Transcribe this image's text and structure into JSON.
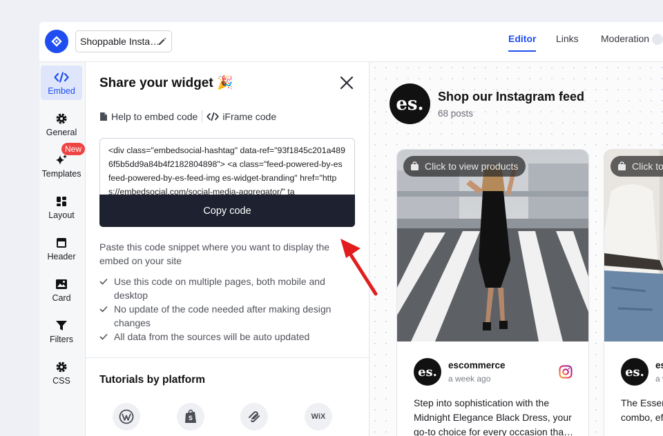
{
  "header": {
    "title_value": "Shoppable Insta…",
    "tabs": [
      {
        "label": "Editor",
        "active": true
      },
      {
        "label": "Links",
        "active": false
      },
      {
        "label": "Moderation",
        "active": false
      }
    ]
  },
  "sidebar": {
    "items": [
      {
        "label": "Embed",
        "icon": "code-icon",
        "active": true
      },
      {
        "label": "General",
        "icon": "gear-icon"
      },
      {
        "label": "Templates",
        "icon": "sparkle-icon",
        "badge": "New"
      },
      {
        "label": "Layout",
        "icon": "layout-icon"
      },
      {
        "label": "Header",
        "icon": "header-icon"
      },
      {
        "label": "Card",
        "icon": "image-icon"
      },
      {
        "label": "Filters",
        "icon": "filter-icon"
      },
      {
        "label": "CSS",
        "icon": "gear-icon"
      }
    ]
  },
  "share": {
    "title": "Share your widget",
    "title_emoji": "🎉",
    "help_link": "Help to embed code",
    "iframe_link": "iFrame code",
    "code_snippet": "<div class=\"embedsocial-hashtag\" data-ref=\"93f1845c201a4896f5b5dd9a84b4f2182804898\"> <a class=\"feed-powered-by-es feed-powered-by-es-feed-img es-widget-branding\" href=\"https://embedsocial.com/social-media-aggregator/\" ta",
    "copy_button": "Copy code",
    "paste_text": "Paste this code snippet where you want to display the embed on your site",
    "checks": [
      "Use this code on multiple pages, both mobile and desktop",
      "No update of the code needed after making design changes",
      "All data from the sources will be auto updated"
    ],
    "tutorials_title": "Tutorials by platform",
    "platforms": [
      "wordpress-icon",
      "shopify-icon",
      "squarespace-icon",
      "WiX"
    ]
  },
  "preview": {
    "feed_avatar": "es.",
    "feed_name": "Shop our Instagram feed",
    "feed_posts": "68 posts",
    "cards": [
      {
        "pill": "Click to view products",
        "avatar": "es.",
        "user": "escommerce",
        "time": "a week ago",
        "text": "Step into sophistication with the Midnight Elegance Black Dress, your go-to choice for every occasion tha…"
      },
      {
        "pill": "Click to view products",
        "avatar": "es.",
        "user": "escommerce",
        "time": "a week ago",
        "text": "The Essential White Tee and Jeans combo, effortless style and comfort"
      }
    ]
  },
  "colors": {
    "accent": "#1f4df0",
    "button_dark": "#1e2130",
    "badge_red": "#ef4444",
    "annotation_arrow": "#e11d1d"
  }
}
